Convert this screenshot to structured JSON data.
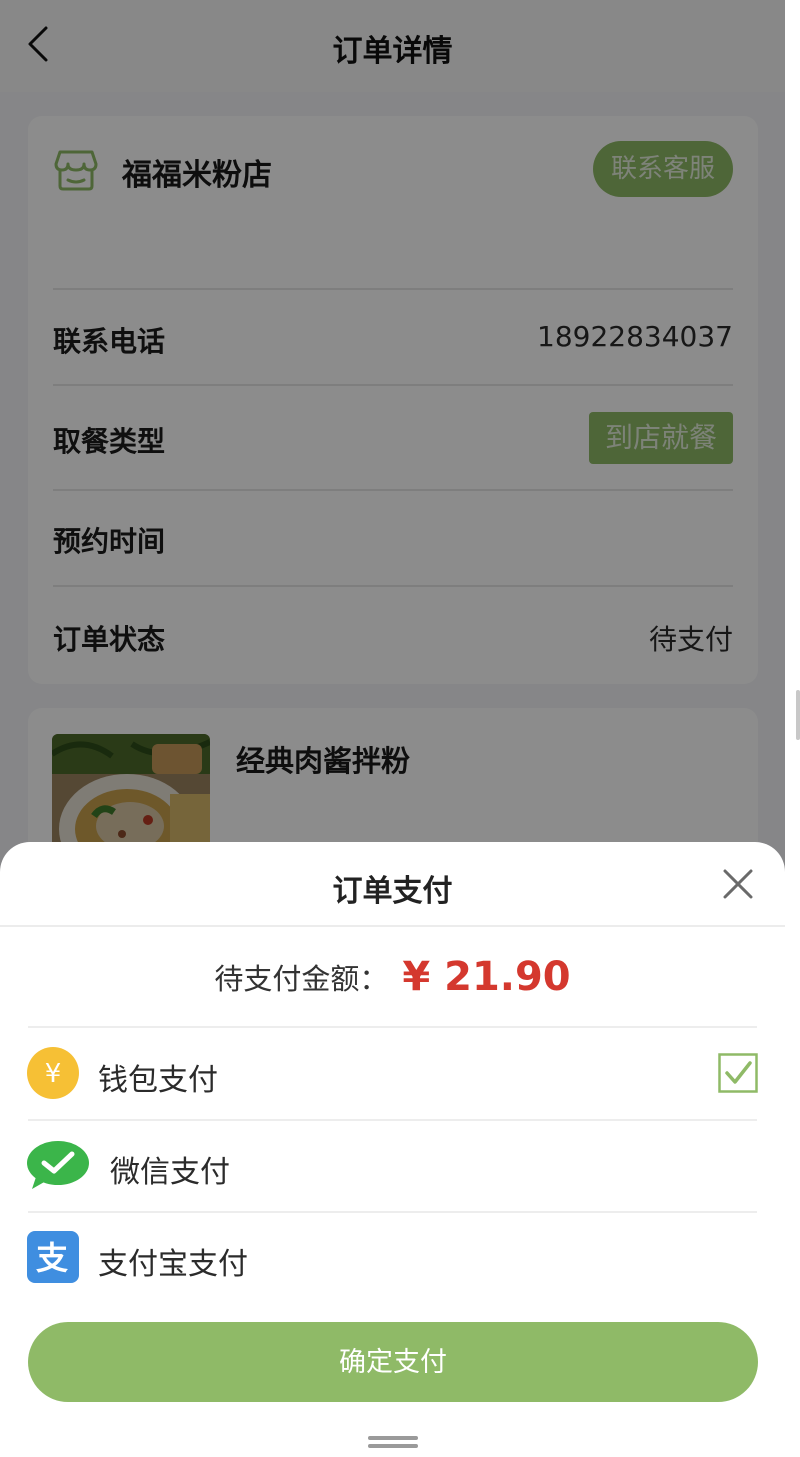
{
  "header": {
    "title": "订单详情",
    "back_icon": "chevron-left-icon"
  },
  "store": {
    "icon": "storefront-icon",
    "name": "福福米粉店",
    "contact_button": "联系客服",
    "rows": [
      {
        "label": "联系电话",
        "value": "18922834037"
      },
      {
        "label": "取餐类型",
        "value": "到店就餐"
      },
      {
        "label": "预约时间",
        "value": ""
      },
      {
        "label": "订单状态",
        "value": "待支付"
      }
    ]
  },
  "item": {
    "name": "经典肉酱拌粉",
    "image": "noodle-dish-photo"
  },
  "payment_sheet": {
    "title": "订单支付",
    "close_icon": "close-icon",
    "amount_label": "待支付金额：",
    "amount_value": "¥ 21.90",
    "methods": [
      {
        "label": "钱包支付",
        "icon": "wallet-yen-icon",
        "selected": true
      },
      {
        "label": "微信支付",
        "icon": "wechat-pay-icon",
        "selected": false
      },
      {
        "label": "支付宝支付",
        "icon": "alipay-icon",
        "selected": false
      }
    ],
    "confirm_button": "确定支付"
  },
  "colors": {
    "accent_green": "#8fba67",
    "price_red": "#d4382e",
    "wallet_yellow": "#f6c035",
    "wechat_green": "#3bb54a",
    "alipay_blue": "#3f8ee0"
  }
}
